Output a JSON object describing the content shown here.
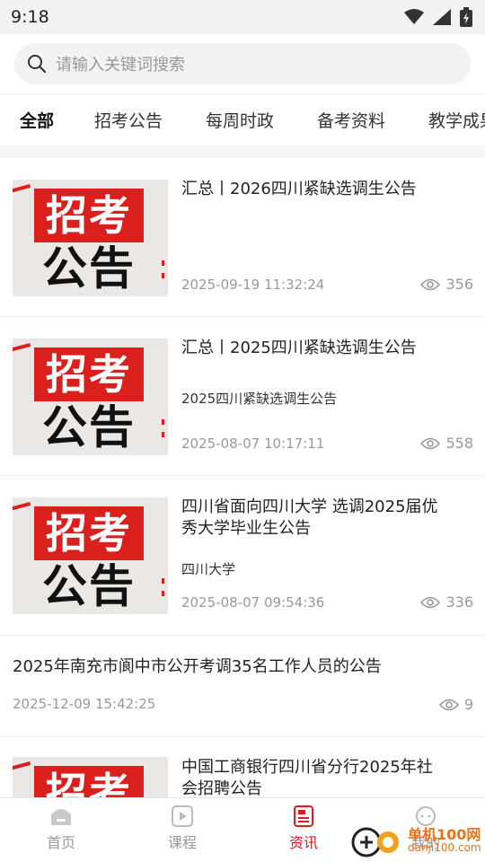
{
  "status_bar": {
    "time": "9:18"
  },
  "search": {
    "placeholder": "请输入关键词搜索"
  },
  "tabs": [
    {
      "label": "全部"
    },
    {
      "label": "招考公告"
    },
    {
      "label": "每周时政"
    },
    {
      "label": "备考资料"
    },
    {
      "label": "教学成果"
    }
  ],
  "thumb": {
    "top_text": "招考",
    "bottom_text": "公告"
  },
  "articles": [
    {
      "title": "汇总丨2026四川紧缺选调生公告",
      "subtitle": "",
      "date": "2025-09-19 11:32:24",
      "views": "356"
    },
    {
      "title": "汇总丨2025四川紧缺选调生公告",
      "subtitle": "2025四川紧缺选调生公告",
      "date": "2025-08-07 10:17:11",
      "views": "558"
    },
    {
      "title_line1": "四川省面向四川大学 选调2025届优",
      "title_line2": "秀大学毕业生公告",
      "subtitle": "四川大学",
      "date": "2025-08-07 09:54:36",
      "views": "336"
    },
    {
      "title": "2025年南充市阆中市公开考调35名工作人员的公告",
      "date": "2025-12-09 15:42:25",
      "views": "9"
    },
    {
      "title_line1": "中国工商银行四川省分行2025年社",
      "title_line2": "会招聘公告"
    }
  ],
  "bottom_nav": [
    {
      "label": "首页",
      "icon": "home-icon"
    },
    {
      "label": "课程",
      "icon": "play-icon"
    },
    {
      "label": "资讯",
      "icon": "news-icon"
    },
    {
      "label": "我的",
      "icon": "user-icon"
    }
  ],
  "watermark": {
    "cn": "单机100网",
    "en": "danji100.com"
  },
  "colors": {
    "accent": "#d9201c",
    "muted": "#999999",
    "watermark": "#e8731a"
  }
}
